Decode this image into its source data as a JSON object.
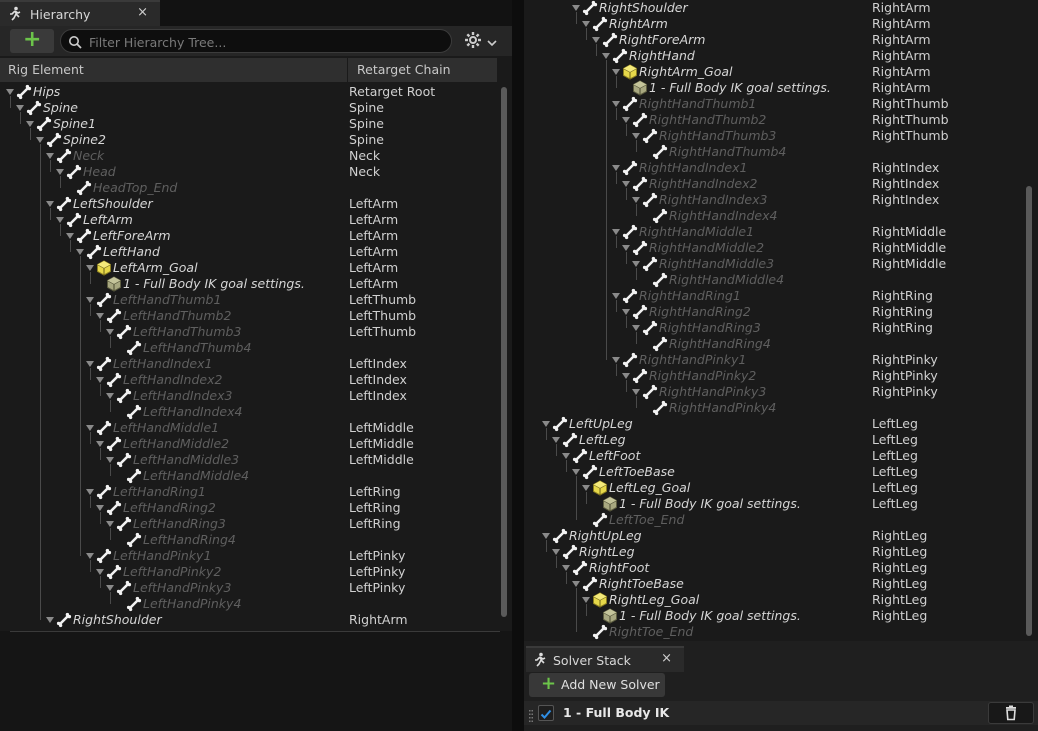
{
  "hierarchy": {
    "tab_label": "Hierarchy",
    "close_glyph": "×",
    "add_glyph": "+",
    "search_placeholder": "Filter Hierarchy Tree...",
    "col_element": "Rig Element",
    "col_chain": "Retarget Chain",
    "rows": [
      {
        "name": "Hips",
        "chain": "Retarget Root"
      },
      {
        "name": "Spine",
        "chain": "Spine"
      },
      {
        "name": "Spine1",
        "chain": "Spine"
      },
      {
        "name": "Spine2",
        "chain": "Spine"
      },
      {
        "name": "Neck",
        "chain": "Neck"
      },
      {
        "name": "Head",
        "chain": "Neck"
      },
      {
        "name": "HeadTop_End",
        "chain": ""
      },
      {
        "name": "LeftShoulder",
        "chain": "LeftArm"
      },
      {
        "name": "LeftArm",
        "chain": "LeftArm"
      },
      {
        "name": "LeftForeArm",
        "chain": "LeftArm"
      },
      {
        "name": "LeftHand",
        "chain": "LeftArm"
      },
      {
        "name": "LeftArm_Goal",
        "chain": "LeftArm"
      },
      {
        "name": "1 - Full Body IK goal settings.",
        "chain": "LeftArm"
      },
      {
        "name": "LeftHandThumb1",
        "chain": "LeftThumb"
      },
      {
        "name": "LeftHandThumb2",
        "chain": "LeftThumb"
      },
      {
        "name": "LeftHandThumb3",
        "chain": "LeftThumb"
      },
      {
        "name": "LeftHandThumb4",
        "chain": ""
      },
      {
        "name": "LeftHandIndex1",
        "chain": "LeftIndex"
      },
      {
        "name": "LeftHandIndex2",
        "chain": "LeftIndex"
      },
      {
        "name": "LeftHandIndex3",
        "chain": "LeftIndex"
      },
      {
        "name": "LeftHandIndex4",
        "chain": ""
      },
      {
        "name": "LeftHandMiddle1",
        "chain": "LeftMiddle"
      },
      {
        "name": "LeftHandMiddle2",
        "chain": "LeftMiddle"
      },
      {
        "name": "LeftHandMiddle3",
        "chain": "LeftMiddle"
      },
      {
        "name": "LeftHandMiddle4",
        "chain": ""
      },
      {
        "name": "LeftHandRing1",
        "chain": "LeftRing"
      },
      {
        "name": "LeftHandRing2",
        "chain": "LeftRing"
      },
      {
        "name": "LeftHandRing3",
        "chain": "LeftRing"
      },
      {
        "name": "LeftHandRing4",
        "chain": ""
      },
      {
        "name": "LeftHandPinky1",
        "chain": "LeftPinky"
      },
      {
        "name": "LeftHandPinky2",
        "chain": "LeftPinky"
      },
      {
        "name": "LeftHandPinky3",
        "chain": "LeftPinky"
      },
      {
        "name": "LeftHandPinky4",
        "chain": ""
      },
      {
        "name": "RightShoulder",
        "chain": "RightArm"
      }
    ]
  },
  "right_tree": {
    "rows": [
      {
        "name": "RightShoulder",
        "chain": "RightArm"
      },
      {
        "name": "RightArm",
        "chain": "RightArm"
      },
      {
        "name": "RightForeArm",
        "chain": "RightArm"
      },
      {
        "name": "RightHand",
        "chain": "RightArm"
      },
      {
        "name": "RightArm_Goal",
        "chain": "RightArm"
      },
      {
        "name": "1 - Full Body IK goal settings.",
        "chain": "RightArm"
      },
      {
        "name": "RightHandThumb1",
        "chain": "RightThumb"
      },
      {
        "name": "RightHandThumb2",
        "chain": "RightThumb"
      },
      {
        "name": "RightHandThumb3",
        "chain": "RightThumb"
      },
      {
        "name": "RightHandThumb4",
        "chain": ""
      },
      {
        "name": "RightHandIndex1",
        "chain": "RightIndex"
      },
      {
        "name": "RightHandIndex2",
        "chain": "RightIndex"
      },
      {
        "name": "RightHandIndex3",
        "chain": "RightIndex"
      },
      {
        "name": "RightHandIndex4",
        "chain": ""
      },
      {
        "name": "RightHandMiddle1",
        "chain": "RightMiddle"
      },
      {
        "name": "RightHandMiddle2",
        "chain": "RightMiddle"
      },
      {
        "name": "RightHandMiddle3",
        "chain": "RightMiddle"
      },
      {
        "name": "RightHandMiddle4",
        "chain": ""
      },
      {
        "name": "RightHandRing1",
        "chain": "RightRing"
      },
      {
        "name": "RightHandRing2",
        "chain": "RightRing"
      },
      {
        "name": "RightHandRing3",
        "chain": "RightRing"
      },
      {
        "name": "RightHandRing4",
        "chain": ""
      },
      {
        "name": "RightHandPinky1",
        "chain": "RightPinky"
      },
      {
        "name": "RightHandPinky2",
        "chain": "RightPinky"
      },
      {
        "name": "RightHandPinky3",
        "chain": "RightPinky"
      },
      {
        "name": "RightHandPinky4",
        "chain": ""
      },
      {
        "name": "LeftUpLeg",
        "chain": "LeftLeg"
      },
      {
        "name": "LeftLeg",
        "chain": "LeftLeg"
      },
      {
        "name": "LeftFoot",
        "chain": "LeftLeg"
      },
      {
        "name": "LeftToeBase",
        "chain": "LeftLeg"
      },
      {
        "name": "LeftLeg_Goal",
        "chain": "LeftLeg"
      },
      {
        "name": "1 - Full Body IK goal settings.",
        "chain": "LeftLeg"
      },
      {
        "name": "LeftToe_End",
        "chain": ""
      },
      {
        "name": "RightUpLeg",
        "chain": "RightLeg"
      },
      {
        "name": "RightLeg",
        "chain": "RightLeg"
      },
      {
        "name": "RightFoot",
        "chain": "RightLeg"
      },
      {
        "name": "RightToeBase",
        "chain": "RightLeg"
      },
      {
        "name": "RightLeg_Goal",
        "chain": "RightLeg"
      },
      {
        "name": "1 - Full Body IK goal settings.",
        "chain": "RightLeg"
      },
      {
        "name": "RightToe_End",
        "chain": ""
      }
    ]
  },
  "solver_stack": {
    "tab_label": "Solver Stack",
    "close_glyph": "×",
    "add_glyph": "+",
    "add_label": "Add New Solver",
    "solver_label": "1 - Full Body IK",
    "solver_enabled": true
  },
  "icons": {
    "bone": "bone-icon",
    "goal": "goal-cube-icon",
    "setting": "goal-setting-icon",
    "tab": "hierarchy-icon",
    "search": "search-icon",
    "gear": "gear-icon",
    "trash": "trash-icon"
  },
  "colors": {
    "accent_green": "#6cc44a",
    "goal_yellow": "#e6d84a",
    "dim_text": "#5f5f5f",
    "check_blue": "#2f8fe6"
  }
}
